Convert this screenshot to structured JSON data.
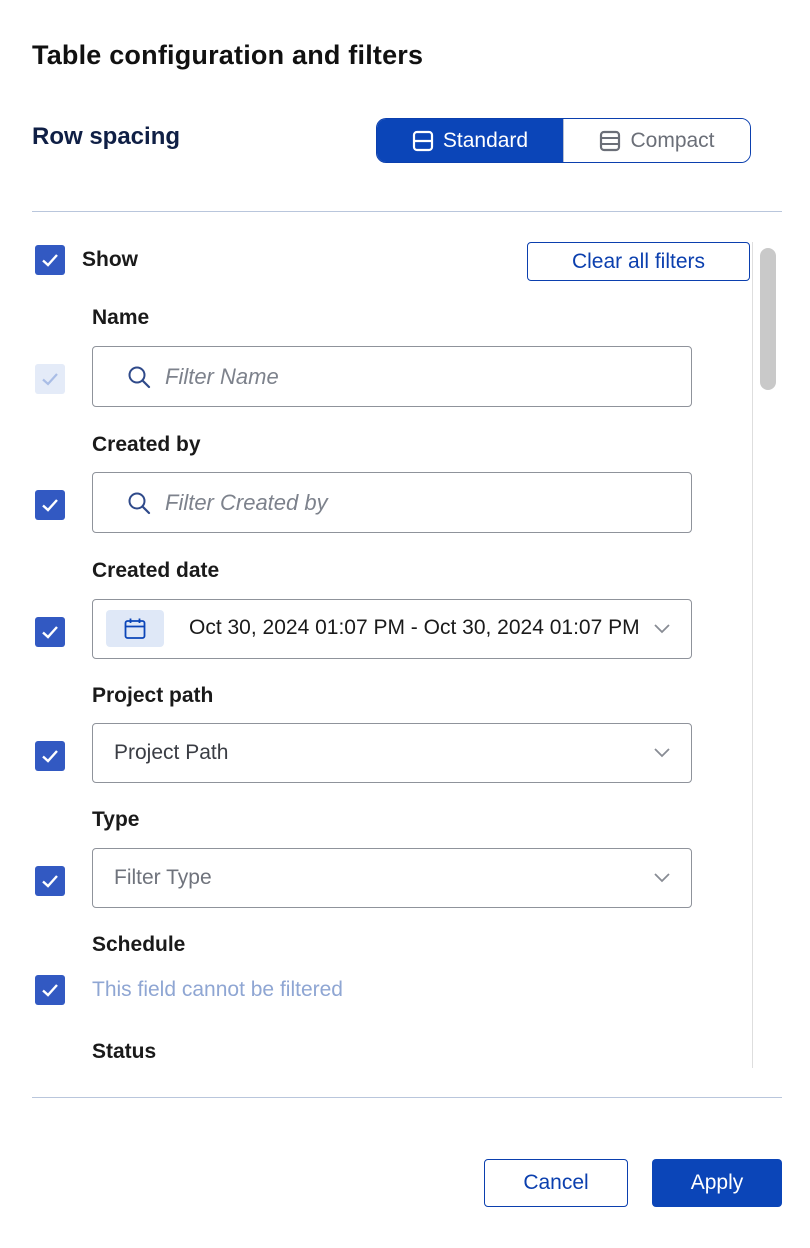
{
  "dialog": {
    "title": "Table configuration and filters"
  },
  "row_spacing": {
    "label": "Row spacing",
    "options": [
      {
        "label": "Standard",
        "selected": true
      },
      {
        "label": "Compact",
        "selected": false
      }
    ]
  },
  "filters": {
    "show_label": "Show",
    "show_checked": true,
    "clear_all_label": "Clear all filters",
    "fields": [
      {
        "label": "Name",
        "checked": true,
        "disabled": true,
        "placeholder": "Filter Name"
      },
      {
        "label": "Created by",
        "checked": true,
        "placeholder": "Filter Created by"
      },
      {
        "label": "Created date",
        "checked": true,
        "value": "Oct 30, 2024 01:07 PM - Oct 30, 2024 01:07 PM"
      },
      {
        "label": "Project path",
        "checked": true,
        "value": "Project Path"
      },
      {
        "label": "Type",
        "checked": true,
        "placeholder": "Filter Type"
      },
      {
        "label": "Schedule",
        "checked": true,
        "note": "This field cannot be filtered"
      },
      {
        "label": "Status"
      }
    ]
  },
  "footer": {
    "cancel_label": "Cancel",
    "apply_label": "Apply"
  },
  "colors": {
    "primary": "#0b45b8",
    "checkbox": "#3259c2",
    "disabled_text": "#8fa6d3"
  }
}
